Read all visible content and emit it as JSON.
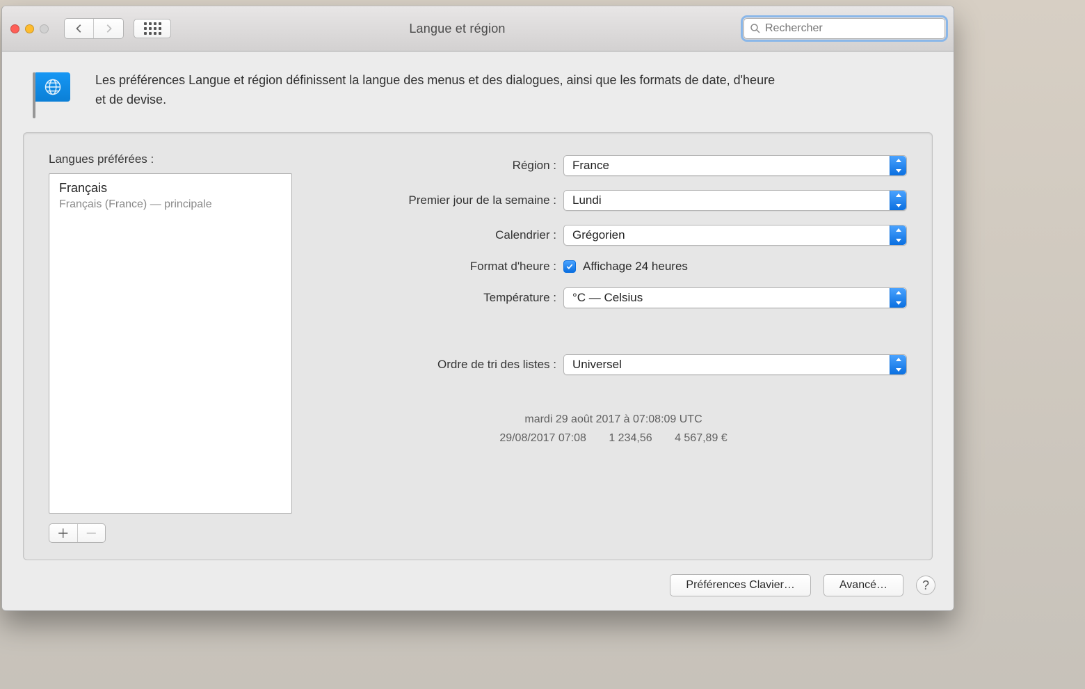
{
  "window": {
    "title": "Langue et région"
  },
  "search": {
    "placeholder": "Rechercher"
  },
  "header": {
    "description": "Les préférences Langue et région définissent la langue des menus et des dialogues, ainsi que les formats de date, d'heure et de devise."
  },
  "languages": {
    "title": "Langues préférées :",
    "items": [
      {
        "name": "Français",
        "subtitle": "Français (France) — principale"
      }
    ]
  },
  "form": {
    "region_label": "Région :",
    "region_value": "France",
    "first_day_label": "Premier jour de la semaine :",
    "first_day_value": "Lundi",
    "calendar_label": "Calendrier :",
    "calendar_value": "Grégorien",
    "time_format_label": "Format d'heure :",
    "time_format_checkbox": "Affichage 24 heures",
    "temperature_label": "Température :",
    "temperature_value": "°C — Celsius",
    "sort_label": "Ordre de tri des listes :",
    "sort_value": "Universel"
  },
  "sample": {
    "line1": "mardi 29 août 2017 à 07:08:09 UTC",
    "line2_date": "29/08/2017 07:08",
    "line2_num": "1 234,56",
    "line2_money": "4 567,89 €"
  },
  "buttons": {
    "keyboard": "Préférences Clavier…",
    "advanced": "Avancé…",
    "help": "?"
  }
}
